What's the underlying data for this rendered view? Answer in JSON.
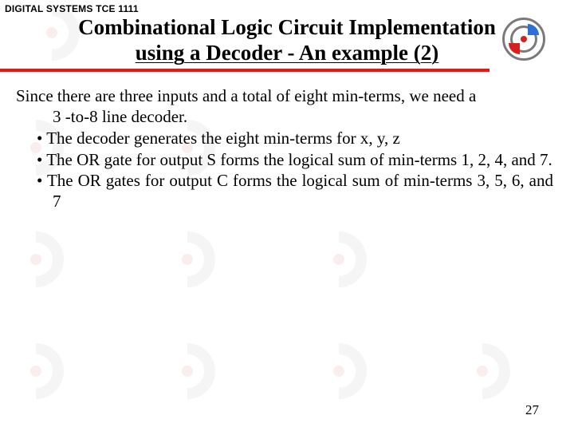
{
  "course_label": "DIGITAL SYSTEMS TCE 1111",
  "title_line1": "Combinational Logic Circuit Implementation",
  "title_line2": "using a Decoder -  An example (2)",
  "lead_a": "Since there are three inputs and a total of eight min-terms, we need a",
  "lead_b": "3 -to-8 line decoder.",
  "bullets": [
    "The decoder generates the eight min-terms for x, y, z",
    "The OR gate for output S forms the logical sum of min-terms 1, 2, 4, and 7.",
    "The OR gates for output C forms the logical sum of min-terms 3, 5, 6, and 7"
  ],
  "page_number": "27"
}
